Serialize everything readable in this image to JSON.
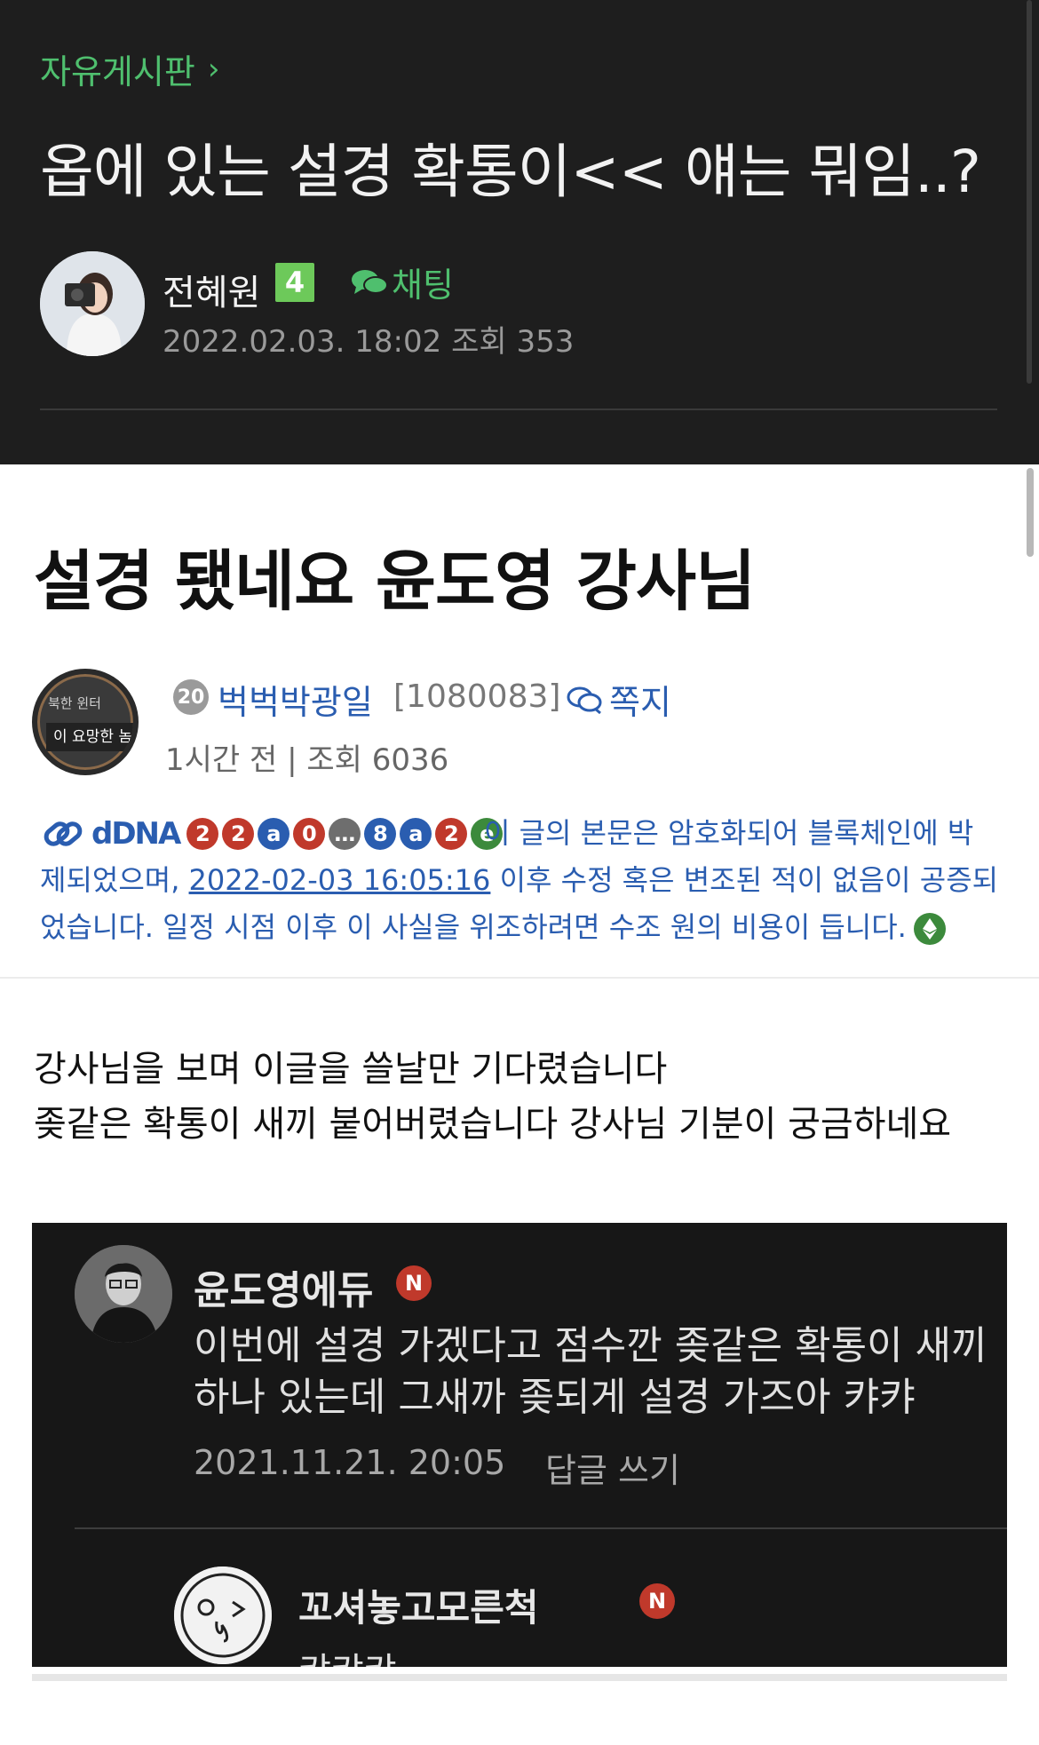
{
  "header": {
    "board_name": "자유게시판",
    "post_title": "옵에 있는 설경 확통이<< 얘는 뭐임..?",
    "author_name": "전혜원",
    "author_level": "4",
    "chat_label": "채팅",
    "post_meta": "2022.02.03. 18:02 조회 353"
  },
  "embedded_post": {
    "title": "설경 됐네요 윤도영 강사님",
    "avatar_line1": "북한 윈터",
    "avatar_line2": "이 요망한 놈",
    "user_level": "20",
    "nickname": "벅벅박광일",
    "user_id": "[1080083]",
    "message_label": "쪽지",
    "meta": "1시간 전 | 조회 6036",
    "dna": {
      "logo_text": "dDNA",
      "hash_chars": [
        "2",
        "2",
        "a",
        "0",
        "…",
        "8",
        "a",
        "2",
        "e"
      ],
      "hash_colors": [
        "#c0392b",
        "#c0392b",
        "#2a5db0",
        "#c0392b",
        "#6e6e6e",
        "#2a5db0",
        "#2a5db0",
        "#c0392b",
        "#3c8a3c"
      ],
      "note_part1": "이 글의 본문은 암호화되어 블록체인에 박제되었으며,",
      "timestamp": "2022-02-03 16:05:16",
      "note_part2": "이후 수정 혹은 변조된 적이 없음이 공증되었습니다. 일정 시점 이후 이 사실을 위조하려면 수조 원의 비용이 듭니다."
    },
    "body_line1": "강사님을 보며 이글을 쓸날만 기다렸습니다",
    "body_line2": "좆같은 확통이 새끼 붙어버렸습니다 강사님 기분이 궁금하네요"
  },
  "comment_screenshot": {
    "commenter": "윤도영에듀",
    "badge": "N",
    "line1": "이번에 설경 가겠다고 점수깐 좆같은 확통이 새끼",
    "line2": "하나 있는데 그새까 좆되게 설경 가즈아 캬캬",
    "date": "2021.11.21. 20:05",
    "reply_label": "답글 쓰기",
    "reply_name": "꼬셔놓고모른척",
    "reply_badge": "N",
    "reply_text": "캬캬캬"
  },
  "colors": {
    "header_bg": "#1e1e1e",
    "accent_green": "#4fbf6e",
    "link_blue": "#2a5db0",
    "n_badge_red": "#c0392b"
  }
}
